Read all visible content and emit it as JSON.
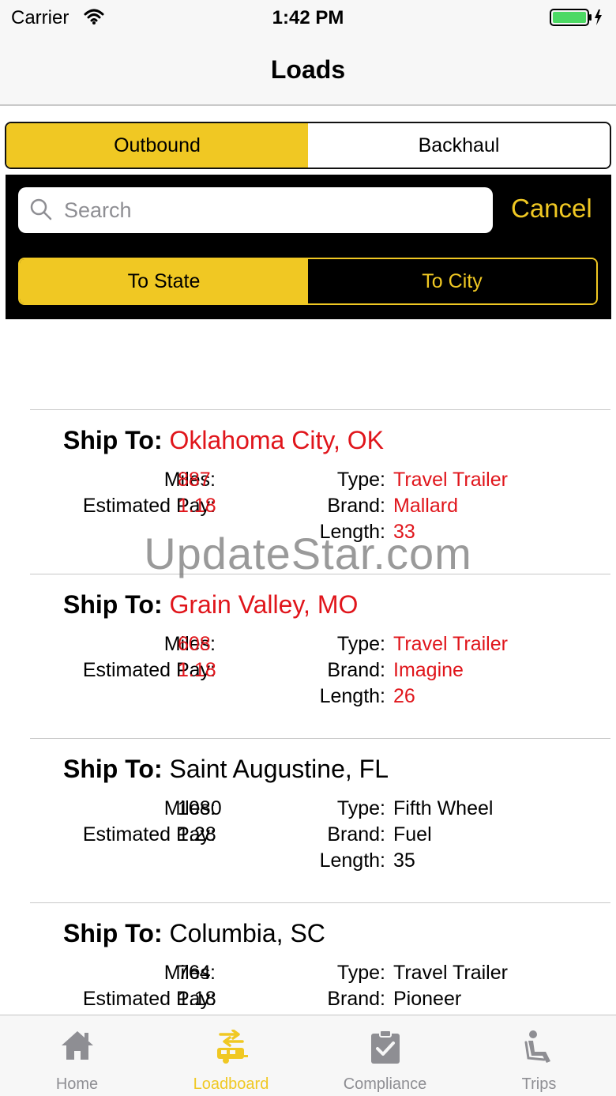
{
  "status_bar": {
    "carrier": "Carrier",
    "time": "1:42 PM"
  },
  "nav": {
    "title": "Loads"
  },
  "direction_segment": {
    "options": [
      "Outbound",
      "Backhaul"
    ],
    "selected": 0
  },
  "search": {
    "placeholder": "Search",
    "value": "",
    "cancel_label": "Cancel"
  },
  "scope_segment": {
    "options": [
      "To State",
      "To City"
    ],
    "selected": 0
  },
  "labels": {
    "ship_to": "Ship To:",
    "miles": "Miles:",
    "estimated_pay": "Estimated Pay:",
    "type": "Type:",
    "brand": "Brand:",
    "length": "Length:"
  },
  "loads": [
    {
      "ship_to": "Oklahoma City, OK",
      "miles": "887",
      "estimated_pay": "1.18",
      "type": "Travel Trailer",
      "brand": "Mallard",
      "length": "33",
      "highlight": true
    },
    {
      "ship_to": "Grain Valley, MO",
      "miles": "608",
      "estimated_pay": "1.18",
      "type": "Travel Trailer",
      "brand": "Imagine",
      "length": "26",
      "highlight": true
    },
    {
      "ship_to": "Saint Augustine, FL",
      "miles": "1080",
      "estimated_pay": "1.28",
      "type": "Fifth Wheel",
      "brand": "Fuel",
      "length": "35",
      "highlight": false
    },
    {
      "ship_to": "Columbia, SC",
      "miles": "764",
      "estimated_pay": "1.18",
      "type": "Travel Trailer",
      "brand": "Pioneer",
      "length": "",
      "highlight": false
    }
  ],
  "watermark": "UpdateStar.com",
  "tabs": [
    {
      "label": "Home",
      "icon": "home-icon"
    },
    {
      "label": "Loadboard",
      "icon": "loadboard-icon"
    },
    {
      "label": "Compliance",
      "icon": "clipboard-check-icon"
    },
    {
      "label": "Trips",
      "icon": "seat-icon"
    }
  ],
  "active_tab": 1,
  "colors": {
    "accent": "#f0c823",
    "highlight_text": "#e0151b",
    "tab_inactive": "#8e8e93"
  }
}
